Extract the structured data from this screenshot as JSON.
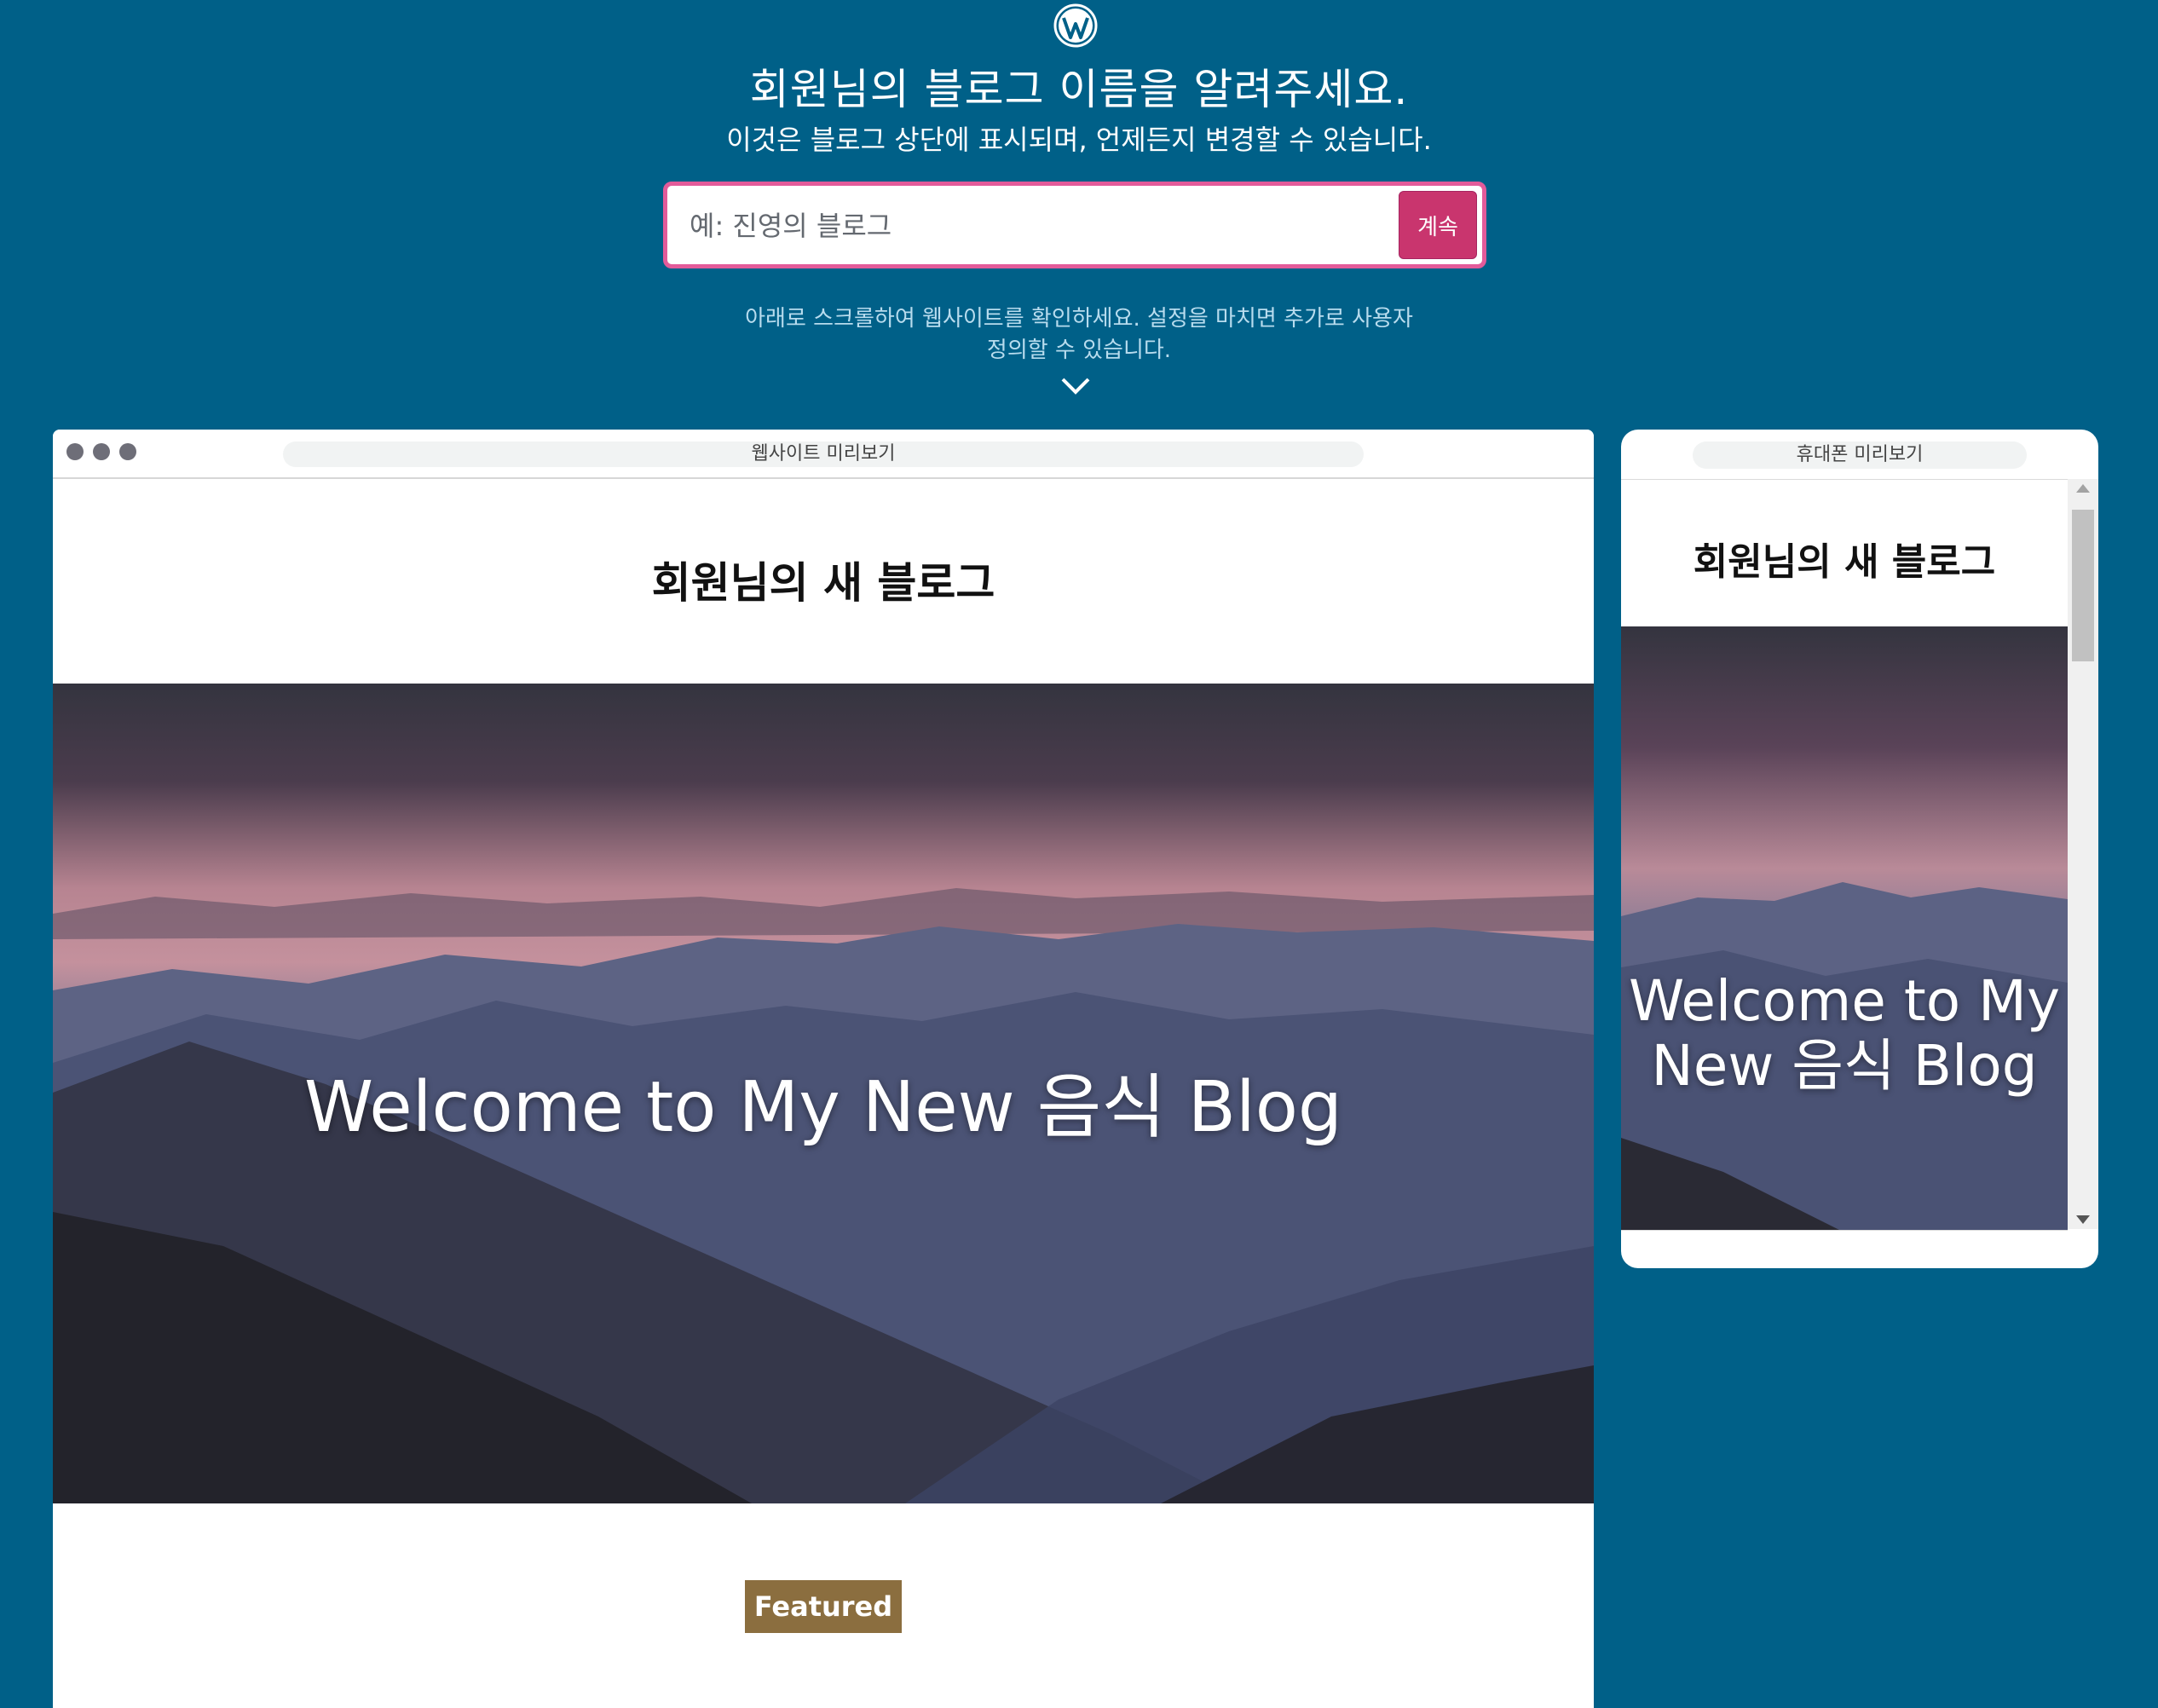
{
  "header": {
    "logo_icon": "wordpress-logo-icon",
    "heading": "회원님의 블로그 이름을 알려주세요.",
    "subheading": "이것은 블로그 상단에 표시되며, 언제든지 변경할 수 있습니다."
  },
  "form": {
    "input_value": "",
    "input_placeholder": "예: 진영의 블로그",
    "continue_label": "계속",
    "focus_color": "#e35b9a",
    "button_color": "#c9356e"
  },
  "hint": {
    "line1": "아래로 스크롤하여 웹사이트를 확인하세요. 설정을 마치면 추가로 사용자",
    "line2": "정의할 수 있습니다.",
    "icon": "chevron-down-icon"
  },
  "desktop_preview": {
    "label": "웹사이트 미리보기",
    "site_title": "회원님의 새 블로그",
    "hero_text": "Welcome to My New 음식 Blog",
    "featured_label": "Featured"
  },
  "mobile_preview": {
    "label": "휴대폰 미리보기",
    "site_title": "회원님의 새 블로그",
    "hero_text": "Welcome to My New 음식 Blog"
  },
  "colors": {
    "background": "#006088",
    "featured_badge": "#8b6e3f"
  }
}
